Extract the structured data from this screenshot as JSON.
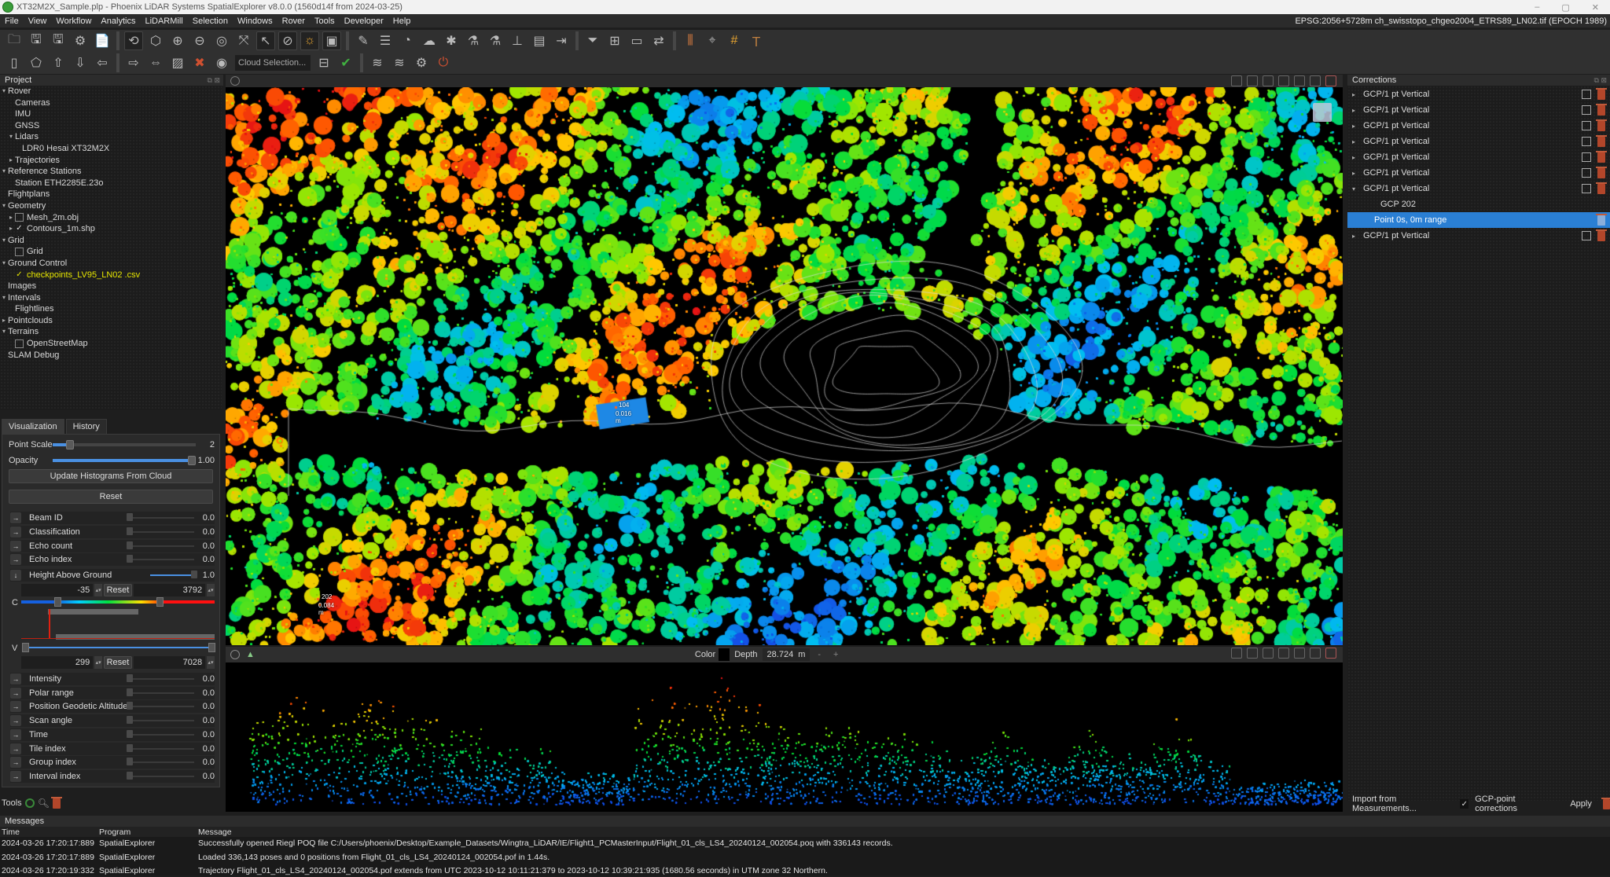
{
  "window": {
    "title": "XT32M2X_Sample.plp - Phoenix LiDAR Systems SpatialExplorer v8.0.0 (1560d14f from 2024-03-25)",
    "controls": [
      "–",
      "▢",
      "✕"
    ]
  },
  "menu": {
    "items": [
      "File",
      "View",
      "Workflow",
      "Analytics",
      "LiDARMill",
      "Selection",
      "Windows",
      "Rover",
      "Tools",
      "Developer",
      "Help"
    ],
    "crs_status": "EPSG:2056+5728m ch_swisstopo_chgeo2004_ETRS89_LN02.tif (EPOCH 1989)"
  },
  "toolbar": {
    "row1_icons": [
      "open-project",
      "save",
      "save-as",
      "project-settings",
      "export-report",
      "orbit",
      "view-3d",
      "zoom-in",
      "zoom-out",
      "screenshot",
      "fit-extents",
      "select-pointer",
      "compass",
      "sun-light",
      "section-box",
      "trajectory-tool",
      "flightlines",
      "measure",
      "cloud-settings",
      "classify",
      "colorize",
      "colorize-2",
      "ground-height",
      "report",
      "import",
      "filter",
      "add-layer",
      "ruler",
      "xyz-transform",
      "chart",
      "location-pin",
      "grid",
      "gnss-antenna"
    ],
    "row2_icons": [
      "box-select",
      "polygon-select",
      "move-up",
      "move-down",
      "move-left",
      "move-right",
      "swap",
      "hatch",
      "cancel-select",
      "eye"
    ],
    "cloud_selection_placeholder": "Cloud Selection...",
    "row2_after": [
      "crop",
      "accept",
      "wifi",
      "wifi-2",
      "gear",
      "power"
    ]
  },
  "project": {
    "header": "Project",
    "tree": [
      {
        "label": "Rover",
        "level": 0,
        "arrow": "down"
      },
      {
        "label": "Cameras",
        "level": 1
      },
      {
        "label": "IMU",
        "level": 1
      },
      {
        "label": "GNSS",
        "level": 1
      },
      {
        "label": "Lidars",
        "level": 1,
        "arrow": "down"
      },
      {
        "label": "LDR0 Hesai XT32M2X",
        "level": 2
      },
      {
        "label": "Trajectories",
        "level": 1,
        "arrow": "right"
      },
      {
        "label": "Reference Stations",
        "level": 0,
        "arrow": "down"
      },
      {
        "label": "Station ETH2285E.23o",
        "level": 1
      },
      {
        "label": "Flightplans",
        "level": 0
      },
      {
        "label": "Geometry",
        "level": 0,
        "arrow": "down"
      },
      {
        "label": "Mesh_2m.obj",
        "level": 1,
        "arrow": "right",
        "checkbox": false
      },
      {
        "label": "Contours_1m.shp",
        "level": 1,
        "arrow": "right",
        "checkbox": true
      },
      {
        "label": "Grid",
        "level": 0,
        "arrow": "down"
      },
      {
        "label": "Grid",
        "level": 1,
        "checkbox": false
      },
      {
        "label": "Ground Control",
        "level": 0,
        "arrow": "down"
      },
      {
        "label": "checkpoints_LV95_LN02 .csv",
        "level": 1,
        "checkbox": true,
        "highlight": true
      },
      {
        "label": "Images",
        "level": 0
      },
      {
        "label": "Intervals",
        "level": 0,
        "arrow": "down"
      },
      {
        "label": "Flightlines",
        "level": 1
      },
      {
        "label": "Pointclouds",
        "level": 0,
        "arrow": "right"
      },
      {
        "label": "Terrains",
        "level": 0,
        "arrow": "down"
      },
      {
        "label": "OpenStreetMap",
        "level": 1,
        "checkbox": false
      },
      {
        "label": "SLAM Debug",
        "level": 0
      }
    ]
  },
  "visualization": {
    "tabs": [
      "Visualization",
      "History"
    ],
    "point_scale": {
      "label": "Point Scale",
      "value": "2",
      "fraction": 0.12
    },
    "opacity": {
      "label": "Opacity",
      "value": "1.00",
      "fraction": 1.0
    },
    "update_btn": "Update Histograms From Cloud",
    "reset_btn": "Reset",
    "attributes_top": [
      {
        "label": "Beam ID",
        "value": "0.0"
      },
      {
        "label": "Classification",
        "value": "0.0"
      },
      {
        "label": "Echo count",
        "value": "0.0"
      },
      {
        "label": "Echo index",
        "value": "0.0"
      }
    ],
    "active_attribute": {
      "label": "Height Above Ground",
      "value": "1.0",
      "fraction": 1.0,
      "color_min": "-35",
      "color_max": "3792",
      "value_min": "299",
      "value_max": "7028",
      "reset": "Reset",
      "c_label": "C",
      "v_label": "V"
    },
    "attributes_bottom": [
      {
        "label": "Intensity",
        "value": "0.0"
      },
      {
        "label": "Polar range",
        "value": "0.0"
      },
      {
        "label": "Position Geodetic Altitude",
        "value": "0.0"
      },
      {
        "label": "Scan angle",
        "value": "0.0"
      },
      {
        "label": "Time",
        "value": "0.0"
      },
      {
        "label": "Tile index",
        "value": "0.0"
      },
      {
        "label": "Group index",
        "value": "0.0"
      },
      {
        "label": "Interval index",
        "value": "0.0"
      }
    ]
  },
  "tools": {
    "label": "Tools"
  },
  "viewport": {
    "labels": [
      {
        "id": "104",
        "dist": "0.016 m"
      },
      {
        "id": "202",
        "dist": "0.084 m"
      }
    ]
  },
  "profile": {
    "color_label": "Color",
    "depth_label": "Depth",
    "depth_value": "28.724",
    "depth_unit": "m",
    "minus": "-",
    "plus": "+"
  },
  "corrections": {
    "header": "Corrections",
    "items": [
      {
        "label": "GCP/1 pt Vertical",
        "expanded": false
      },
      {
        "label": "GCP/1 pt Vertical",
        "expanded": false
      },
      {
        "label": "GCP/1 pt Vertical",
        "expanded": false
      },
      {
        "label": "GCP/1 pt Vertical",
        "expanded": false
      },
      {
        "label": "GCP/1 pt Vertical",
        "expanded": false
      },
      {
        "label": "GCP/1 pt Vertical",
        "expanded": false
      },
      {
        "label": "GCP/1 pt Vertical",
        "expanded": true,
        "children": [
          "GCP  202",
          "Point  0s, 0m range"
        ]
      },
      {
        "label": "GCP/1 pt Vertical",
        "expanded": false
      }
    ],
    "import_btn": "Import from Measurements...",
    "gcp_checkbox": "GCP-point corrections",
    "apply_btn": "Apply"
  },
  "messages": {
    "header": "Messages",
    "columns": [
      "Time",
      "Program",
      "Message"
    ],
    "rows": [
      {
        "time": "2024-03-26 17:20:17:889",
        "program": "SpatialExplorer",
        "message": "Successfully opened Riegl POQ file C:/Users/phoenix/Desktop/Example_Datasets/Wingtra_LiDAR/IE/Flight1_PCMasterInput/Flight_01_cls_LS4_20240124_002054.poq with 336143 records."
      },
      {
        "time": "2024-03-26 17:20:17:889",
        "program": "SpatialExplorer",
        "message": "Loaded 336,143 poses and 0 positions from Flight_01_cls_LS4_20240124_002054.pof in 1.44s."
      },
      {
        "time": "2024-03-26 17:20:19:332",
        "program": "SpatialExplorer",
        "message": "Trajectory Flight_01_cls_LS4_20240124_002054.pof extends from UTC 2023-10-12 10:11:21:379 to 2023-10-12 10:39:21:935 (1680.56 seconds) in UTM zone 32 Northern."
      }
    ]
  },
  "colors": {
    "accent": "#2a7fd4",
    "highlight_text": "#e6e600",
    "bg": "#1e1e1e"
  }
}
